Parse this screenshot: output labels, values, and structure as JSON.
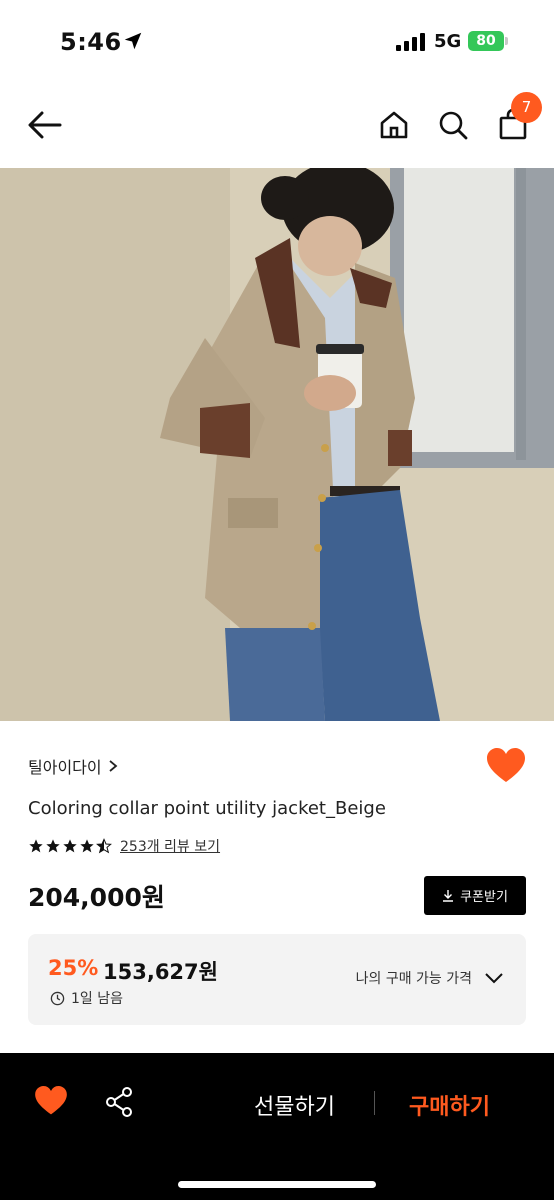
{
  "status_bar": {
    "time": "5:46",
    "network": "5G",
    "battery": "80"
  },
  "header": {
    "back_icon": "arrow-left-icon",
    "home_icon": "home-icon",
    "search_icon": "search-icon",
    "cart_icon": "shopping-bag-icon",
    "cart_count": "7"
  },
  "product": {
    "brand": "틸아이다이",
    "title": "Coloring collar point utility jacket_Beige",
    "rating": 4.5,
    "review_link": "253개 리뷰 보기",
    "price": "204,000원",
    "coupon_label": "쿠폰받기",
    "liked": true
  },
  "discount": {
    "rate": "25%",
    "price": "153,627원",
    "deadline": "1일 남음",
    "my_price_label": "나의 구매 가능 가격"
  },
  "bottom_bar": {
    "gift_label": "선물하기",
    "buy_label": "구매하기"
  },
  "colors": {
    "accent": "#ff5a1f",
    "battery": "#34c759"
  }
}
